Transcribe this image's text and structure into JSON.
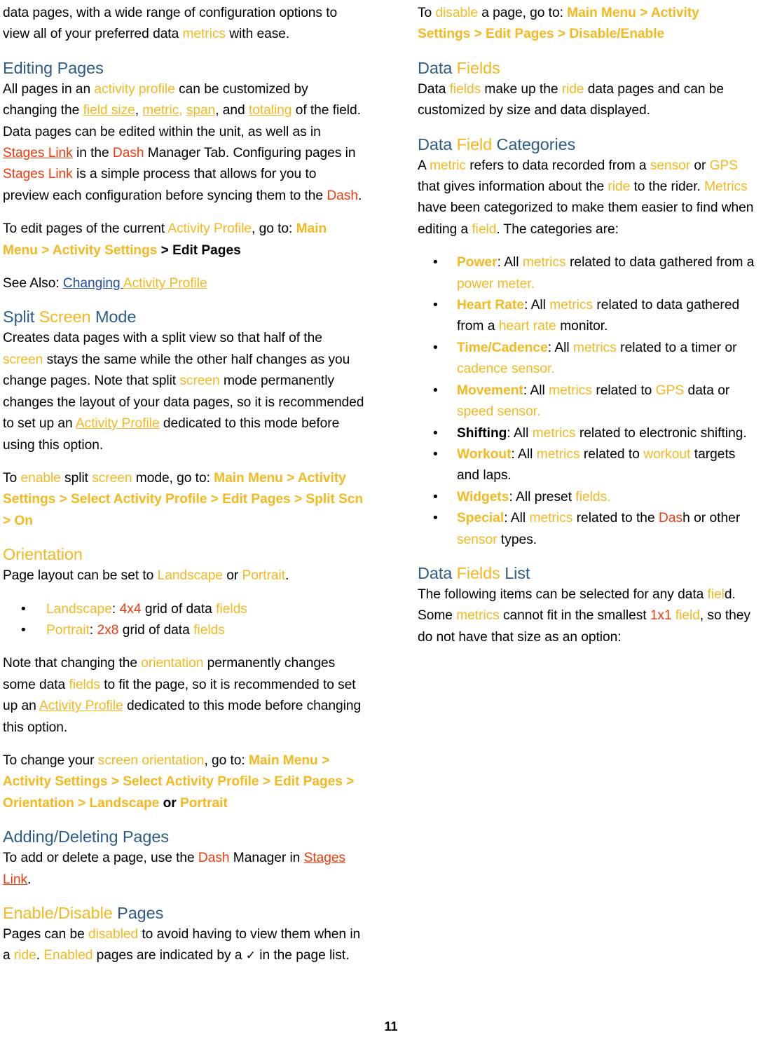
{
  "document": {
    "page_number": "11",
    "colors": {
      "amber": "#F5B820",
      "red_orange": "#F03A0C",
      "heading_blue": "#2E5C8A",
      "link_blue": "#1F4E9C",
      "body_text": "#000000",
      "background": "#FFFFFF"
    },
    "bullet_glyph": "•",
    "check_glyph": "✓"
  },
  "left_column": {
    "intro_paragraph": {
      "line1_plain": "data pages, with a wide range of configuration options",
      "line2_plain": "to view all of your preferred data ",
      "metrics": "metrics",
      "line2_end": " with ease."
    },
    "editing_pages": {
      "heading_word1": "Editing",
      "heading_word2": " Pages",
      "body_1": "All pages in an ",
      "activity_profile": "activity profile",
      "body_2": " can be customized by changing the ",
      "field_size": "field size",
      "comma_1": ", ",
      "metric": "metric,",
      "space_1": " ",
      "span": "span",
      "comma_2": ", and ",
      "totaling": "totaling",
      "body_3": " of the field. Data pages can be edited within the unit, as well as in ",
      "stages_link_1": "Stages Link",
      "body_4": " in the ",
      "dash_1": "Dash",
      "body_5": " Manager Tab. Configuring pages in ",
      "stages_link_2": "Stages Link",
      "body_6": " is a simple process that allows for you to preview each configuration before syncing them to the ",
      "dash_2": "Dash",
      "body_7": "."
    },
    "edit_pages_path": {
      "lead": "To edit pages of the current ",
      "activity_profile": "Activity Profile",
      "mid": ", go to: ",
      "path_amber": "Main Menu > Activity Settings",
      "path_black": " > Edit Pages"
    },
    "see_also": {
      "lead": "See Also: ",
      "link_blue": "Changing ",
      "link_amber": "Activity Profile"
    },
    "split_screen": {
      "heading_word1": "Split",
      "heading_word2": " Screen",
      "heading_word3": " Mode",
      "body_1": "Creates data pages with a split view so that half of the ",
      "screen_1": "screen",
      "body_2": " stays the same while the other half changes as you change pages. Note that split ",
      "screen_2": "screen",
      "body_3": " mode permanently changes the layout of your data pages, so it is recommended to set up an ",
      "activity_profile": "Activity Profile",
      "body_4": " dedicated to this mode before using this option."
    },
    "split_screen_path": {
      "lead": "To ",
      "enable": "enable",
      "mid_1": " split ",
      "screen": "screen",
      "mid_2": " mode, go to: ",
      "path": "Main Menu > Activity Settings > Select Activity Profile > Edit Pages > Split Scn > On"
    },
    "orientation": {
      "heading": "Orientation",
      "body_1": "Page layout can be set to ",
      "landscape": "Landscape",
      "body_2": " or ",
      "portrait": "Portrait",
      "body_3": "."
    },
    "orientation_bullets": [
      {
        "label": "Landscape",
        "label_color": "amber",
        "sep": ": ",
        "value": "4x4",
        "value_color": "red",
        "mid": " grid of data ",
        "tail": "fields",
        "tail_color": "amber"
      },
      {
        "label": "Portrait",
        "label_color": "amber",
        "sep": ": ",
        "value": "2x8",
        "value_color": "red",
        "mid": " grid of data ",
        "tail": "fields",
        "tail_color": "amber"
      }
    ],
    "orientation_note": {
      "body_1": "Note that changing the ",
      "orientation": "orientation",
      "body_2": " permanently changes some data ",
      "fields": "fields",
      "body_3": " to fit the page, so it is recommended to set up an ",
      "activity_profile": "Activity Profile",
      "body_4": " dedicated to this mode before changing this option."
    },
    "orientation_path": {
      "lead": "To change your ",
      "screen_orientation": "screen orientation",
      "mid": ", go to: ",
      "path_1": "Main Menu > Activity Settings > Select Activity Profile > Edit Pages > Orientation > Landscape",
      "or": " or ",
      "path_2": "Portrait"
    },
    "adding_deleting": {
      "heading": "Adding/Deleting Pages",
      "body_1": "To add or delete a page, use the ",
      "dash": "Dash",
      "body_2": " Manager in ",
      "stages_link": "Stages Link",
      "body_3": "."
    },
    "enable_disable": {
      "heading_word1": "Enable/Disable",
      "heading_word2": " Pages",
      "body_1": "Pages can be ",
      "disabled": "disabled",
      "body_2": " to avoid having to view them when in a ",
      "ride": "ride",
      "body_3": ". ",
      "enabled": "Enabled",
      "body_4": " pages are indicated by a ",
      "check": "✓",
      "body_5": " in the page list."
    }
  },
  "right_column": {
    "disable_path": {
      "lead": "To ",
      "disable": "disable",
      "mid": " a page, go to: ",
      "path": "Main Menu > Activity Settings > Edit Pages > Disable/Enable"
    },
    "data_fields": {
      "heading_word1": "Data",
      "heading_word2": " Fields",
      "body_1": "Data ",
      "fields": "fields",
      "body_2": " make up the ",
      "ride": "ride",
      "body_3": " data pages and can be customized by size and data displayed."
    },
    "data_field_categories": {
      "heading_word1": "Data",
      "heading_word2": " Field",
      "heading_word3": " Categories",
      "body_1": "A ",
      "metric": "metric",
      "body_2": " refers to data recorded from a ",
      "sensor": "sensor",
      "body_3": " or ",
      "gps": "GPS",
      "body_4": " that gives information about the ",
      "ride": "ride",
      "body_5": " to the rider. ",
      "metrics": "Metrics",
      "body_6": " have been categorized to make them easier to find when editing a ",
      "field": "field",
      "body_7": ". The categories are:"
    },
    "category_bullets": [
      {
        "label": "Power",
        "label_color": "amber",
        "parts": [
          {
            "t": ": All ",
            "c": "black"
          },
          {
            "t": "metrics",
            "c": "amber"
          },
          {
            "t": " related to data gathered from a ",
            "c": "black"
          },
          {
            "t": "power meter.",
            "c": "amber"
          }
        ]
      },
      {
        "label": "Heart Rate",
        "label_color": "amber",
        "parts": [
          {
            "t": ": All ",
            "c": "black"
          },
          {
            "t": "metrics",
            "c": "amber"
          },
          {
            "t": " related to data gathered from a ",
            "c": "black"
          },
          {
            "t": "heart rate",
            "c": "amber"
          },
          {
            "t": " monitor.",
            "c": "black"
          }
        ]
      },
      {
        "label": "Time/Cadence",
        "label_color": "amber",
        "parts": [
          {
            "t": ": All ",
            "c": "black"
          },
          {
            "t": "metrics",
            "c": "amber"
          },
          {
            "t": " related to a timer or ",
            "c": "black"
          },
          {
            "t": "cadence sensor.",
            "c": "amber"
          }
        ]
      },
      {
        "label": "Movement",
        "label_color": "amber",
        "parts": [
          {
            "t": ": All ",
            "c": "black"
          },
          {
            "t": "metrics",
            "c": "amber"
          },
          {
            "t": " related to ",
            "c": "black"
          },
          {
            "t": "GPS",
            "c": "amber"
          },
          {
            "t": " data or ",
            "c": "black"
          },
          {
            "t": "speed sensor.",
            "c": "amber"
          }
        ]
      },
      {
        "label": "Shifting",
        "label_color": "black",
        "parts": [
          {
            "t": ": All ",
            "c": "black"
          },
          {
            "t": "metrics",
            "c": "amber"
          },
          {
            "t": " related to electronic shifting.",
            "c": "black"
          }
        ]
      },
      {
        "label": "Workout",
        "label_color": "amber",
        "parts": [
          {
            "t": ": All ",
            "c": "black"
          },
          {
            "t": "metrics",
            "c": "amber"
          },
          {
            "t": " related to ",
            "c": "black"
          },
          {
            "t": "workout",
            "c": "amber"
          },
          {
            "t": " targets and laps.",
            "c": "black"
          }
        ]
      },
      {
        "label": "Widgets",
        "label_color": "amber",
        "parts": [
          {
            "t": ": All preset ",
            "c": "black"
          },
          {
            "t": "fields.",
            "c": "amber"
          }
        ]
      },
      {
        "label": "Special",
        "label_color": "amber",
        "parts": [
          {
            "t": ": All ",
            "c": "black"
          },
          {
            "t": "metrics",
            "c": "amber"
          },
          {
            "t": " related to the ",
            "c": "black"
          },
          {
            "t": "Das",
            "c": "red"
          },
          {
            "t": "h or other ",
            "c": "black"
          },
          {
            "t": "sensor",
            "c": "amber"
          },
          {
            "t": " types.",
            "c": "black"
          }
        ]
      }
    ],
    "data_fields_list": {
      "heading_word1": "Data",
      "heading_word2": " Fields",
      "heading_word3": " List",
      "body_1": "The following items can be selected for any data ",
      "fiel": "fiel",
      "body_2": "d. Some ",
      "metrics": "metrics",
      "body_3": " cannot fit in the smallest ",
      "one_by_one": "1x1",
      "body_4": " ",
      "field": "field",
      "body_5": ", so they do not have that size as an option:"
    }
  }
}
